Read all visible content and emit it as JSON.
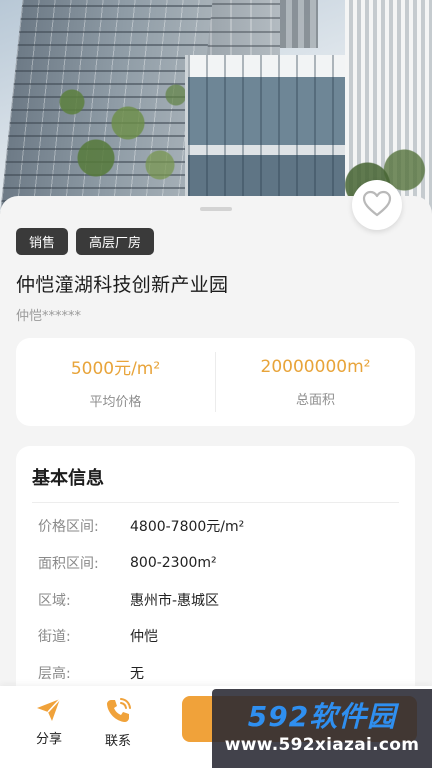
{
  "tags": [
    "销售",
    "高层厂房"
  ],
  "title": "仲恺潼湖科技创新产业园",
  "subtitle": "仲恺******",
  "stats": [
    {
      "value": "5000元/m²",
      "label": "平均价格"
    },
    {
      "value": "20000000m²",
      "label": "总面积"
    }
  ],
  "info": {
    "title": "基本信息",
    "rows": [
      {
        "key": "价格区间:",
        "value": "4800-7800元/m²"
      },
      {
        "key": "面积区间:",
        "value": "800-2300m²"
      },
      {
        "key": "区域:",
        "value": "惠州市-惠城区"
      },
      {
        "key": "街道:",
        "value": "仲恺"
      },
      {
        "key": "层高:",
        "value": "无"
      }
    ]
  },
  "bottom": {
    "share_label": "分享",
    "contact_label": "联系"
  },
  "icons": {
    "favorite": "heart-outline-icon",
    "share": "paper-plane-icon",
    "contact": "phone-icon"
  },
  "colors": {
    "accent": "#e8a43a",
    "cta": "#f0a23a",
    "tag_bg": "#3a3a3a"
  },
  "watermark": {
    "logo_num": "592",
    "logo_text": "软件园",
    "url": "www.592xiazai.com"
  }
}
